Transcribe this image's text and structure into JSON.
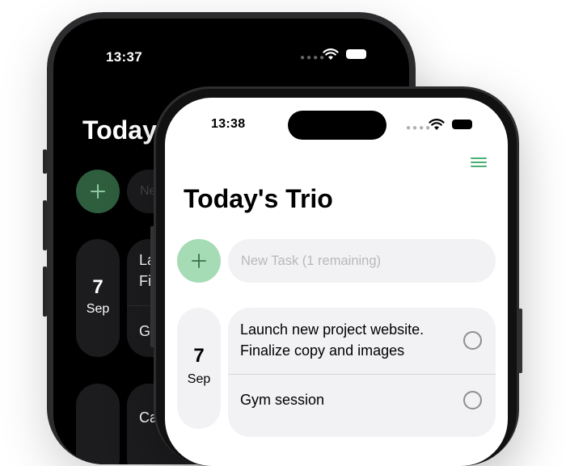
{
  "colors": {
    "accent_green": "#a5dbb5",
    "accent_green_dark": "#2e5e3e",
    "menu_green": "#4caf73",
    "dark_bg": "#000000",
    "light_bg": "#ffffff",
    "card_light": "#f2f2f4",
    "card_dark": "#1c1c1e"
  },
  "back_phone": {
    "theme": "dark",
    "status_time": "13:37",
    "title": "Today's Trio",
    "title_visible": "Today'",
    "input_placeholder_visible": "Ne",
    "day": {
      "number": "7",
      "month": "Sep"
    },
    "tasks_visible": [
      "Lau",
      "Fir",
      "Gy"
    ],
    "next_task_visible": "Ca",
    "icons": [
      "wifi-icon",
      "battery-icon",
      "menu-icon",
      "plus-icon"
    ]
  },
  "front_phone": {
    "theme": "light",
    "status_time": "13:38",
    "title": "Today's Trio",
    "new_task_placeholder": "New Task (1 remaining)",
    "day": {
      "number": "7",
      "month": "Sep"
    },
    "tasks": [
      {
        "text": "Launch new project website. Finalize copy and images",
        "done": false
      },
      {
        "text": "Gym session",
        "done": false
      }
    ],
    "icons": [
      "wifi-icon",
      "battery-icon",
      "menu-icon",
      "plus-icon",
      "checkbox-icon"
    ]
  }
}
